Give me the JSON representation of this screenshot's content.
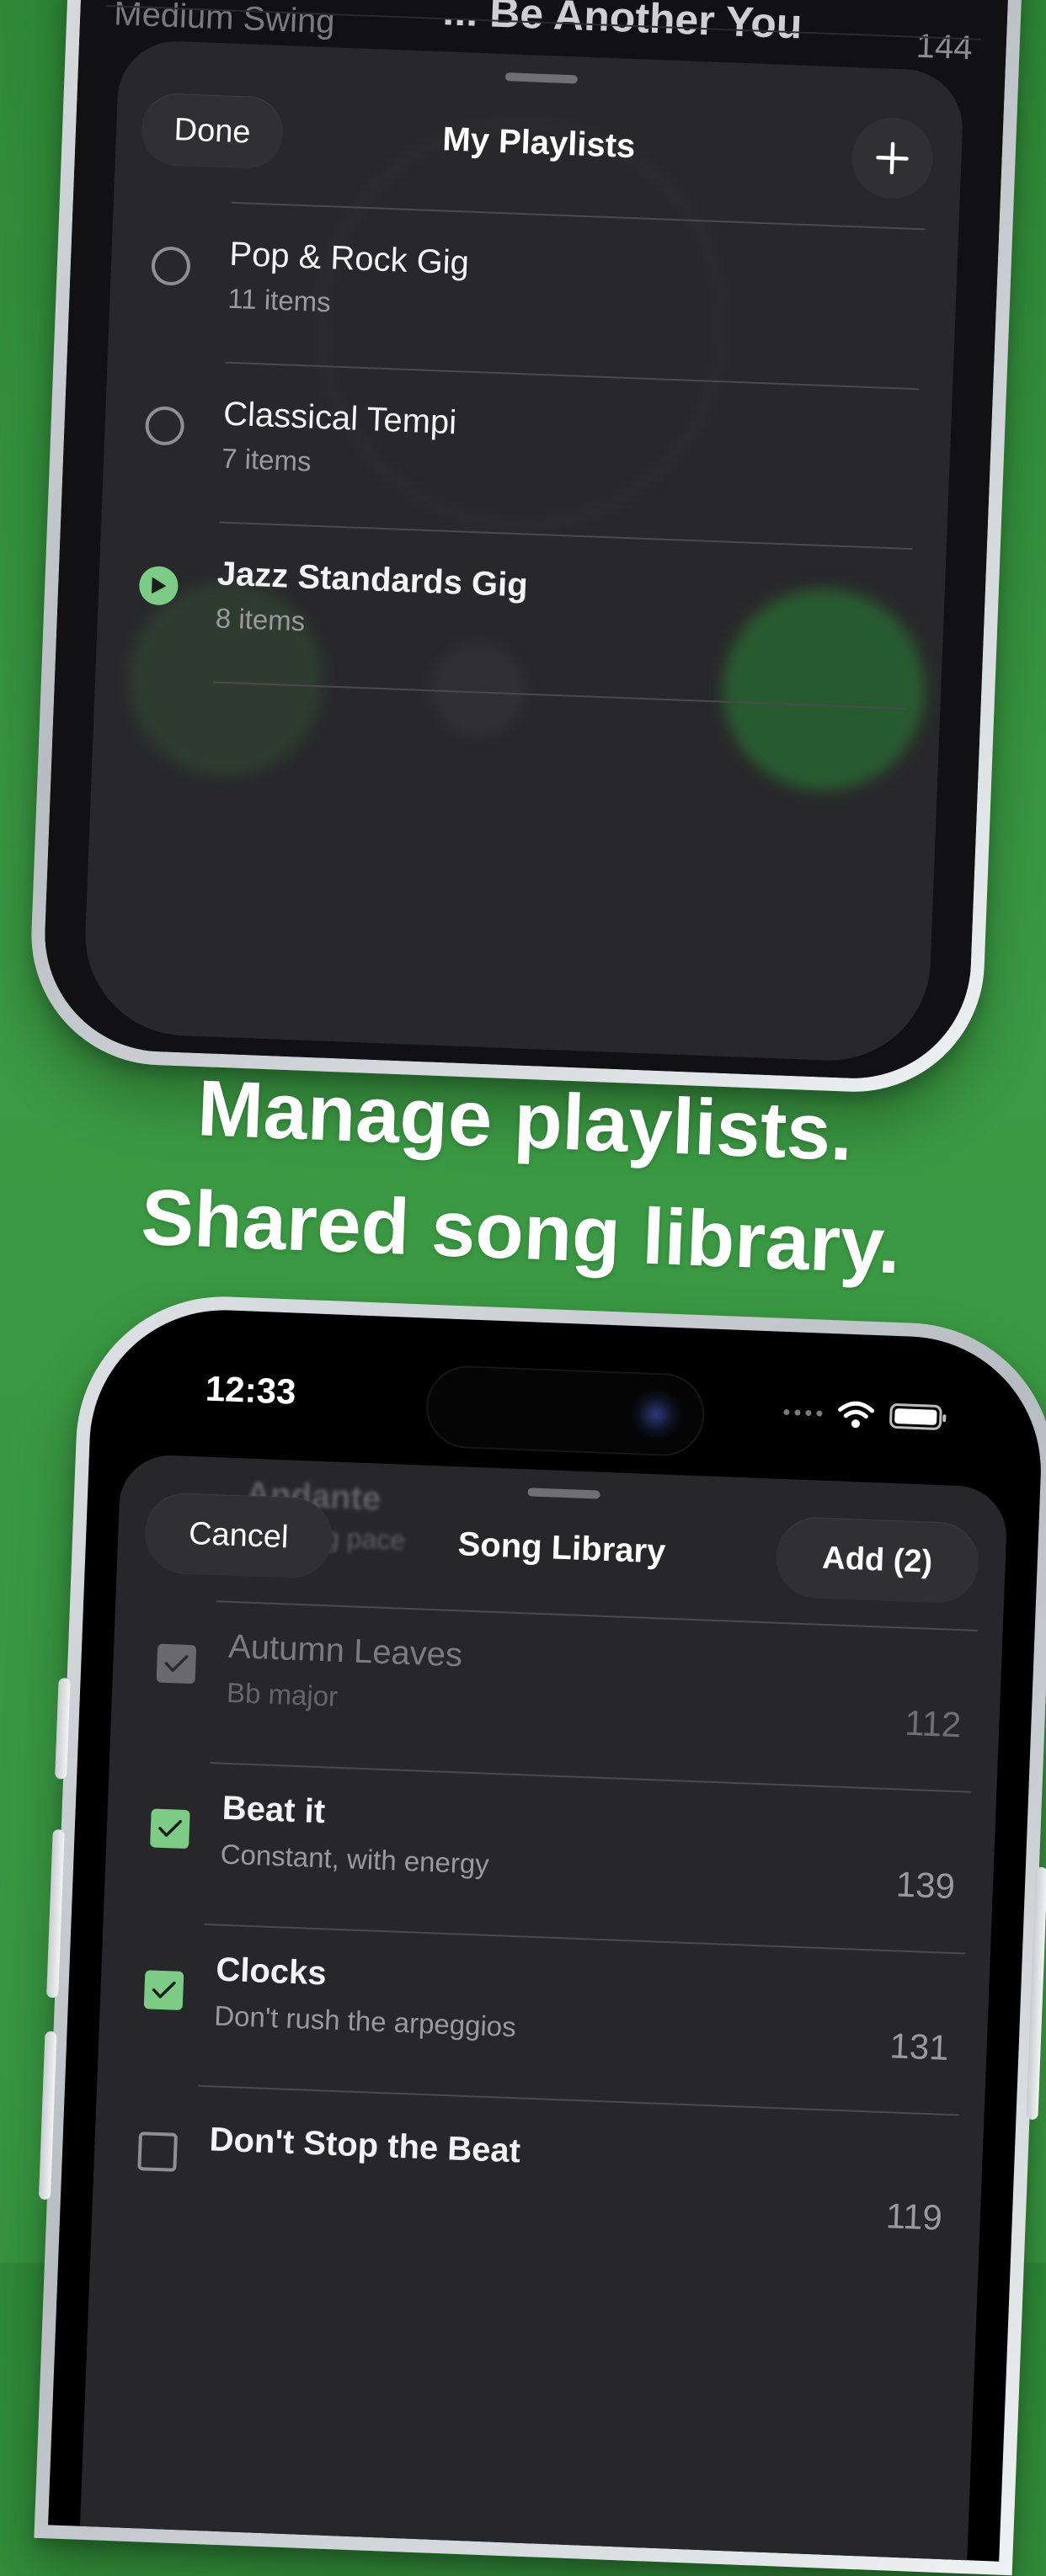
{
  "colors": {
    "background": "#35933d",
    "accent_green": "#7dcc85",
    "sheet": "#2a2a2c",
    "text_primary": "#ffffff",
    "text_secondary": "#9a9a9d"
  },
  "top_screen": {
    "background_song": {
      "subtitle": "Medium Swing",
      "title": "... Be Another You",
      "number": "144"
    },
    "playlists_sheet": {
      "done_label": "Done",
      "title": "My Playlists",
      "add_icon": "plus-icon",
      "items": [
        {
          "title": "Pop & Rock Gig",
          "subtitle": "11 items",
          "selected": false
        },
        {
          "title": "Classical Tempi",
          "subtitle": "7 items",
          "selected": false
        },
        {
          "title": "Jazz Standards Gig",
          "subtitle": "8 items",
          "selected": true
        }
      ]
    }
  },
  "headline": {
    "line1": "Manage playlists.",
    "line2": "Shared song library."
  },
  "bottom_screen": {
    "status_bar": {
      "time": "12:33",
      "icons": [
        "cellular-icon",
        "wifi-icon",
        "battery-icon"
      ]
    },
    "background_text": {
      "title": "Andante",
      "subtitle": "Walking pace"
    },
    "song_library_sheet": {
      "cancel_label": "Cancel",
      "title": "Song Library",
      "add_label": "Add (2)",
      "songs": [
        {
          "title": "Autumn Leaves",
          "subtitle": "Bb major",
          "number": "112",
          "checked": true,
          "disabled": true
        },
        {
          "title": "Beat it",
          "subtitle": "Constant, with energy",
          "number": "139",
          "checked": true,
          "disabled": false
        },
        {
          "title": "Clocks",
          "subtitle": "Don't rush the arpeggios",
          "number": "131",
          "checked": true,
          "disabled": false
        },
        {
          "title": "Don't Stop the Beat",
          "subtitle": "",
          "number": "119",
          "checked": false,
          "disabled": false
        }
      ]
    }
  }
}
